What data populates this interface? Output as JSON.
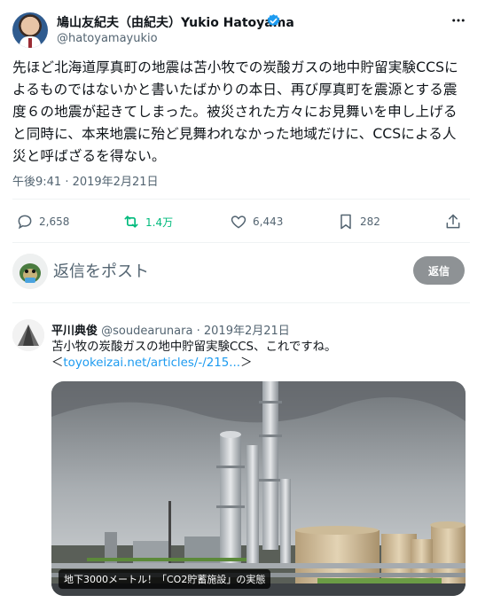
{
  "tweet": {
    "author_name": "鳩山友紀夫（由紀夫）Yukio Hatoyama",
    "author_handle": "@hatoyamayukio",
    "text": "先ほど北海道厚真町の地震は苫小牧での炭酸ガスの地中貯留実験CCSによるものではないかと書いたばかりの本日、再び厚真町を震源とする震度６の地震が起きてしまった。被災された方々にお見舞いを申し上げると同時に、本来地震に殆ど見舞われなかった地域だけに、CCSによる人災と呼ばざるを得ない。",
    "timestamp": "午後9:41 · 2019年2月21日",
    "stats": {
      "replies": "2,658",
      "retweets": "1.4万",
      "likes": "6,443",
      "bookmarks": "282"
    }
  },
  "reply_box": {
    "placeholder": "返信をポスト",
    "button_label": "返信"
  },
  "quoted_reply": {
    "name": "平川典俊",
    "handle": "@soudearunara",
    "date": "2019年2月21日",
    "separator": "·",
    "text": "苫小牧の炭酸ガスの地中貯留実験CCS、これですね。",
    "link_open": "＜",
    "link_text": "toyokeizai.net/articles/-/215...",
    "link_close": "＞",
    "image_caption": "地下3000メートル！「CO2貯蓄施設」の実態"
  },
  "colors": {
    "accent_blue": "#1d9bf0",
    "retweet_green": "#00ba7c",
    "muted_text": "#536471",
    "reply_button_bg": "#8e9295"
  },
  "icons": [
    "verified-badge-icon",
    "more-options-icon",
    "reply-icon",
    "retweet-icon",
    "like-icon",
    "bookmark-icon",
    "share-icon"
  ]
}
